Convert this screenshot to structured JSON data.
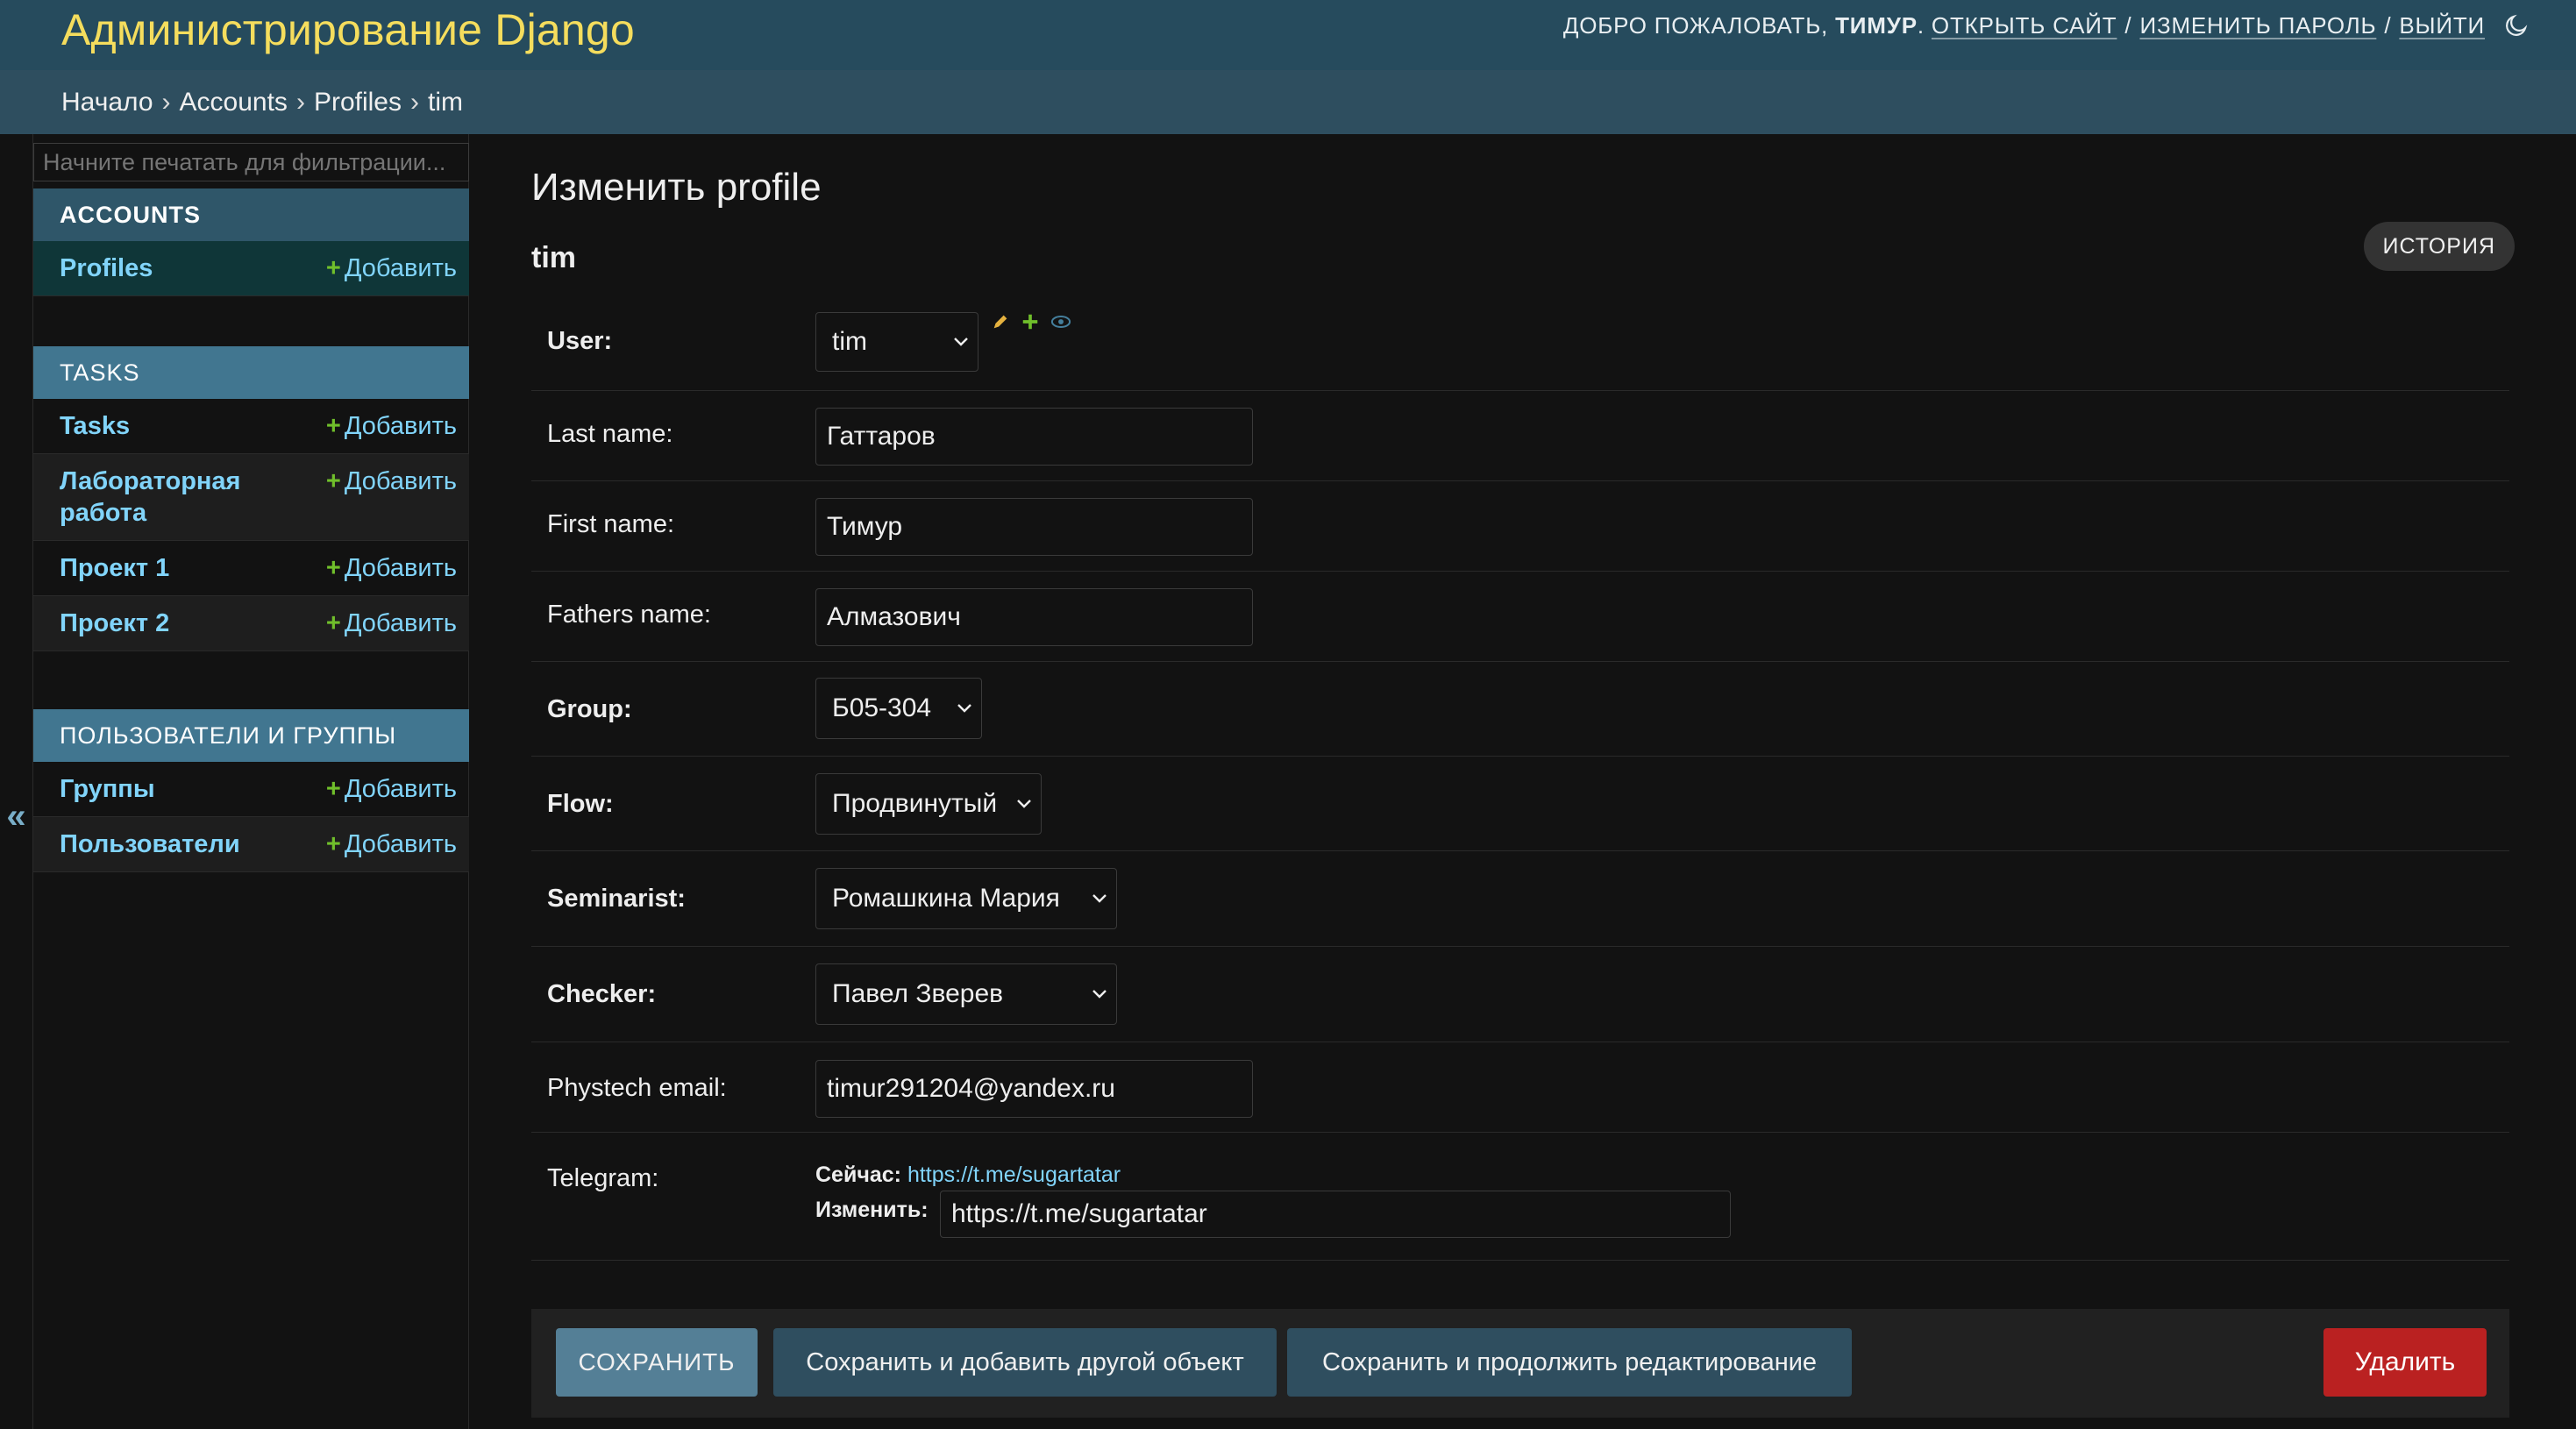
{
  "header": {
    "site_name": "Администрирование Django",
    "welcome": "Добро пожаловать,",
    "username": "Тимур",
    "view_site": "Открыть сайт",
    "change_password": "Изменить пароль",
    "logout": "Выйти",
    "separator": "/",
    "dot": ".",
    "theme_icon": "moon-icon"
  },
  "breadcrumbs": [
    "Начало",
    "Accounts",
    "Profiles",
    "tim"
  ],
  "breadcrumb_arrow": "›",
  "sidebar": {
    "filter_placeholder": "Начните печатать для фильтрации...",
    "collapse_symbol": "«",
    "add_label": "Добавить",
    "plus": "+",
    "modules": [
      {
        "caption": "Accounts",
        "models": [
          "Profiles"
        ]
      },
      {
        "caption": "Tasks",
        "models": [
          "Tasks",
          "Лабораторная работа",
          "Проект 1",
          "Проект 2"
        ]
      },
      {
        "caption": "Пользователи и группы",
        "models": [
          "Группы",
          "Пользователи"
        ]
      }
    ]
  },
  "content": {
    "title": "Изменить profile",
    "object_name": "tim",
    "history_label": "История",
    "fields": {
      "user": {
        "label": "User:",
        "value": "tim"
      },
      "last_name": {
        "label": "Last name:",
        "value": "Гаттаров"
      },
      "first_name": {
        "label": "First name:",
        "value": "Тимур"
      },
      "fathers_name": {
        "label": "Fathers name:",
        "value": "Алмазович"
      },
      "group": {
        "label": "Group:",
        "value": "Б05-304"
      },
      "flow": {
        "label": "Flow:",
        "value": "Продвинутый"
      },
      "seminarist": {
        "label": "Seminarist:",
        "value": "Ромашкина Мария"
      },
      "checker": {
        "label": "Checker:",
        "value": "Павел Зверев"
      },
      "phystech_email": {
        "label": "Phystech email:",
        "value": "timur291204@yandex.ru"
      },
      "telegram": {
        "label": "Telegram:",
        "currently_label": "Сейчас:",
        "currently_value": "https://t.me/sugartatar",
        "change_label": "Изменить:",
        "value": "https://t.me/sugartatar"
      }
    }
  },
  "submit": {
    "save": "Сохранить",
    "save_add": "Сохранить и добавить другой объект",
    "save_continue": "Сохранить и продолжить редактирование",
    "delete": "Удалить"
  },
  "colors": {
    "header_bg": "#264b5d",
    "site_name": "#f5dd5d",
    "link": "#81d4fa",
    "delete": "#ba2121"
  }
}
